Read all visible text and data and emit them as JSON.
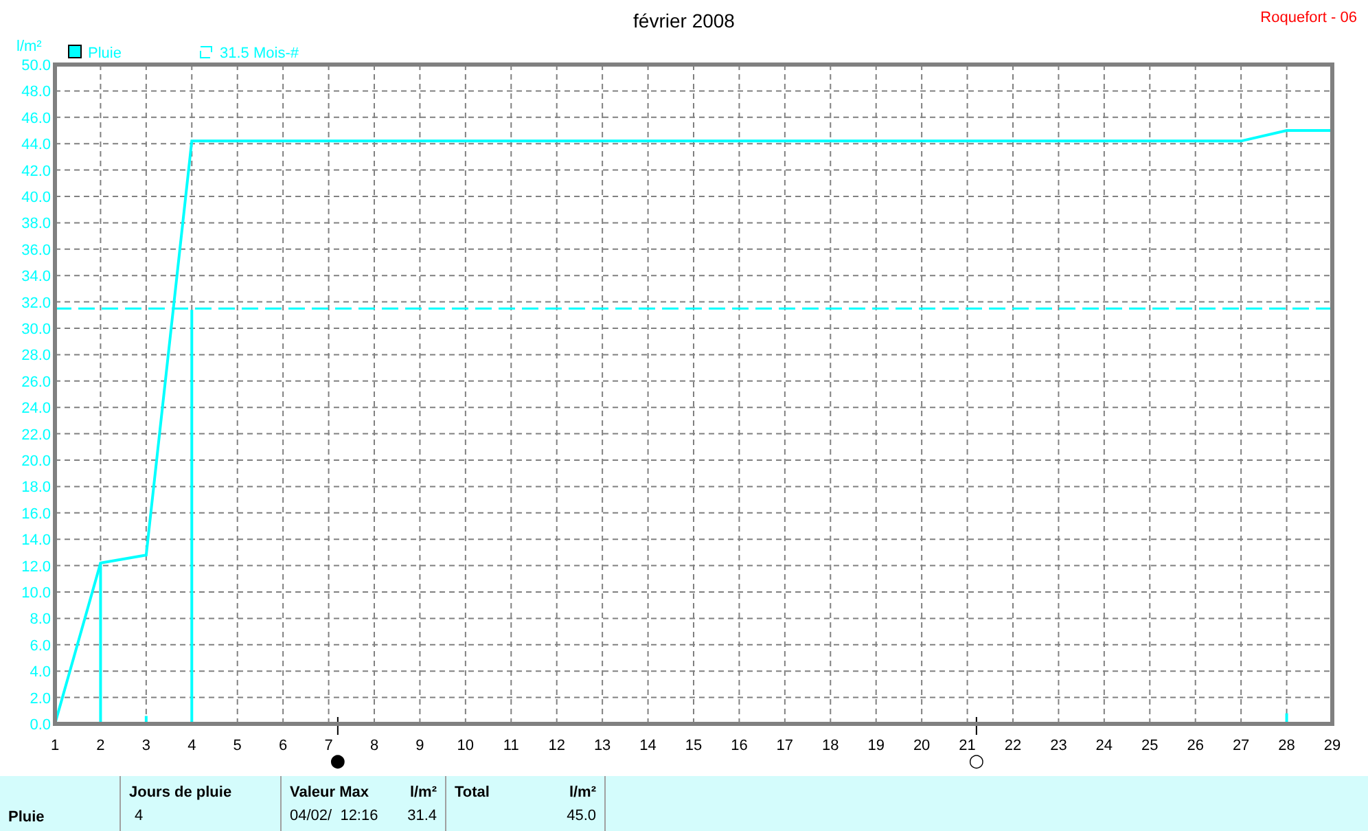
{
  "header": {
    "station": "Roquefort - 06"
  },
  "chart": {
    "chart_data": {
      "type": "line",
      "title": "février 2008",
      "ylabel": "l/m²",
      "x": [
        1,
        2,
        3,
        4,
        5,
        6,
        7,
        8,
        9,
        10,
        11,
        12,
        13,
        14,
        15,
        16,
        17,
        18,
        19,
        20,
        21,
        22,
        23,
        24,
        25,
        26,
        27,
        28,
        29
      ],
      "series": [
        {
          "name": "Pluie",
          "color": "#00ffff",
          "values": [
            0,
            12.2,
            12.8,
            44.2,
            44.2,
            44.2,
            44.2,
            44.2,
            44.2,
            44.2,
            44.2,
            44.2,
            44.2,
            44.2,
            44.2,
            44.2,
            44.2,
            44.2,
            44.2,
            44.2,
            44.2,
            44.2,
            44.2,
            44.2,
            44.2,
            44.2,
            44.2,
            45.0,
            45.0
          ]
        },
        {
          "type": "bar",
          "color": "#00ffff",
          "values": [
            0,
            12.2,
            0.6,
            31.4,
            0,
            0,
            0,
            0,
            0,
            0,
            0,
            0,
            0,
            0,
            0,
            0,
            0,
            0,
            0,
            0,
            0,
            0,
            0,
            0,
            0,
            0,
            0,
            0.8,
            0
          ]
        }
      ],
      "xlim": [
        1,
        29
      ],
      "ylim": [
        0,
        50
      ],
      "xticks": [
        1,
        2,
        3,
        4,
        5,
        6,
        7,
        8,
        9,
        10,
        11,
        12,
        13,
        14,
        15,
        16,
        17,
        18,
        19,
        20,
        21,
        22,
        23,
        24,
        25,
        26,
        27,
        28,
        29
      ],
      "yticks": [
        {
          "value": 0,
          "label": "0.0"
        },
        {
          "value": 2,
          "label": "2.0"
        },
        {
          "value": 4,
          "label": "4.0"
        },
        {
          "value": 6,
          "label": "6.0"
        },
        {
          "value": 8,
          "label": "8.0"
        },
        {
          "value": 10,
          "label": "10.0"
        },
        {
          "value": 12,
          "label": "12.0"
        },
        {
          "value": 14,
          "label": "14.0"
        },
        {
          "value": 16,
          "label": "16.0"
        },
        {
          "value": 18,
          "label": "18.0"
        },
        {
          "value": 20,
          "label": "20.0"
        },
        {
          "value": 22,
          "label": "22.0"
        },
        {
          "value": 24,
          "label": "24.0"
        },
        {
          "value": 26,
          "label": "26.0"
        },
        {
          "value": 28,
          "label": "28.0"
        },
        {
          "value": 30,
          "label": "30.0"
        },
        {
          "value": 32,
          "label": "32.0"
        },
        {
          "value": 34,
          "label": "34.0"
        },
        {
          "value": 36,
          "label": "36.0"
        },
        {
          "value": 38,
          "label": "38.0"
        },
        {
          "value": 40,
          "label": "40.0"
        },
        {
          "value": 42,
          "label": "42.0"
        },
        {
          "value": 44,
          "label": "44.0"
        },
        {
          "value": 46,
          "label": "46.0"
        },
        {
          "value": 48,
          "label": "48.0"
        },
        {
          "value": 50,
          "label": "50.0"
        }
      ],
      "grid": true,
      "legend": true,
      "ref_lines": [
        {
          "axis": "y",
          "value": 31.5,
          "label": "31.5 Mois-#",
          "color": "#00ffff",
          "line_style": "dashed"
        }
      ],
      "annotations": [
        "●",
        "○"
      ]
    }
  },
  "summary": {
    "row_label": "Pluie",
    "cells": [
      {
        "heading": "Jours de pluie",
        "value": "4"
      },
      {
        "heading": "Valeur Max",
        "unit": "l/m²",
        "date": "04/02/  12:16",
        "value": "31.4"
      },
      {
        "heading": "Total",
        "unit": "l/m²",
        "value": "45.0"
      }
    ]
  }
}
